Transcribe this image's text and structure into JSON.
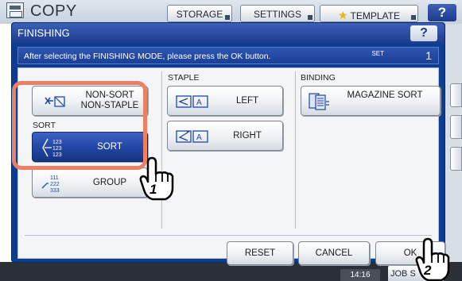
{
  "app": {
    "title": "COPY",
    "tabs": [
      "STORAGE",
      "SETTINGS",
      "TEMPLATE"
    ],
    "help_label": "?",
    "time": "14:16",
    "jobs_label": "JOB S"
  },
  "dialog": {
    "title": "FINISHING",
    "help_label": "?",
    "info_text": "After selecting the FINISHING MODE, please press the OK button.",
    "set_label": "SET",
    "set_count": "1"
  },
  "sections": {
    "sort_label": "SORT",
    "staple_label": "STAPLE",
    "binding_label": "BINDING"
  },
  "buttons": {
    "non_sort_line1": "NON-SORT",
    "non_sort_line2": "NON-STAPLE",
    "sort": "SORT",
    "group": "GROUP",
    "staple_left": "LEFT",
    "staple_right": "RIGHT",
    "magazine_sort": "MAGAZINE SORT",
    "reset": "RESET",
    "cancel": "CANCEL",
    "ok": "OK"
  },
  "icon_text": {
    "sort_digits": [
      "123",
      "123",
      "123"
    ],
    "group_digits": [
      "111",
      "222",
      "333"
    ],
    "staple_letter": "A"
  },
  "annotations": [
    "1",
    "2"
  ],
  "colors": {
    "dialog_blue": "#0d3d91",
    "selected_button": "#2145a3",
    "highlight": "#ec8065"
  }
}
